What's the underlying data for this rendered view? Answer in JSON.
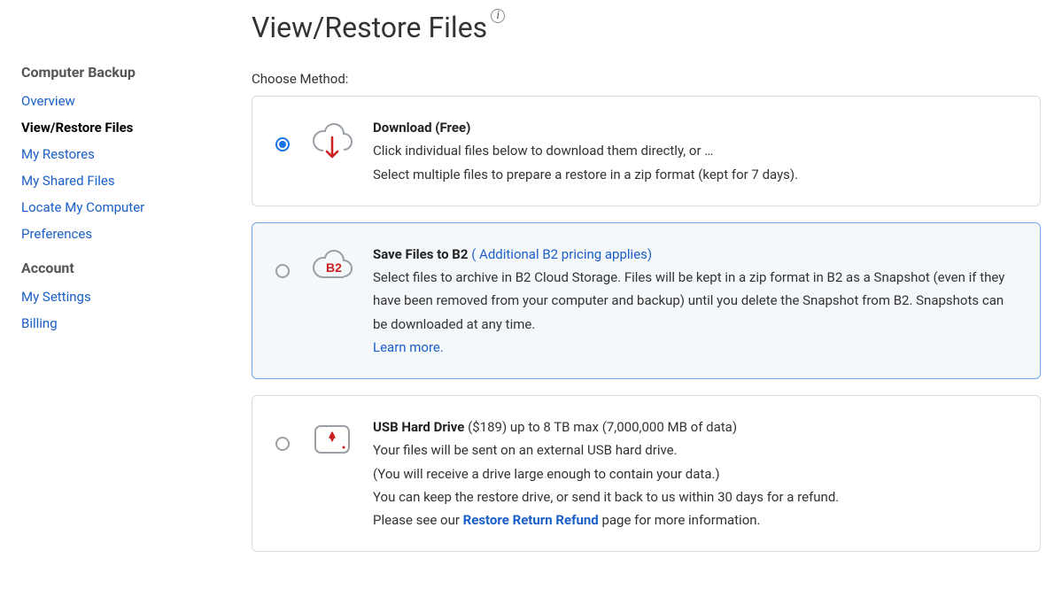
{
  "sidebar": {
    "section1_title": "Computer Backup",
    "items1": [
      {
        "label": "Overview",
        "active": false,
        "name": "overview"
      },
      {
        "label": "View/Restore Files",
        "active": true,
        "name": "view-restore-files"
      },
      {
        "label": "My Restores",
        "active": false,
        "name": "my-restores"
      },
      {
        "label": "My Shared Files",
        "active": false,
        "name": "my-shared-files"
      },
      {
        "label": "Locate My Computer",
        "active": false,
        "name": "locate-my-computer"
      },
      {
        "label": "Preferences",
        "active": false,
        "name": "preferences"
      }
    ],
    "section2_title": "Account",
    "items2": [
      {
        "label": "My Settings",
        "active": false,
        "name": "my-settings"
      },
      {
        "label": "Billing",
        "active": false,
        "name": "billing"
      }
    ]
  },
  "page": {
    "title": "View/Restore Files",
    "info_glyph": "i",
    "choose_label": "Choose Method:"
  },
  "methods": {
    "download": {
      "title": "Download (Free)",
      "line1": "Click individual files below to download them directly, or …",
      "line2": "Select multiple files to prepare a restore in a zip format (kept for 7 days)."
    },
    "b2": {
      "title": "Save Files to B2",
      "title_link": "( Additional B2 pricing applies)",
      "body": "Select files to archive in B2 Cloud Storage. Files will be kept in a zip format in B2 as a Snapshot (even if they have been removed from your computer and backup) until you delete the Snapshot from B2. Snapshots can be downloaded at any time.",
      "learn_more": "Learn more."
    },
    "usb": {
      "title": "USB Hard Drive",
      "title_extra": " ($189) up to 8 TB max (7,000,000 MB of data)",
      "line1": "Your files will be sent on an external USB hard drive.",
      "line2": "(You will receive a drive large enough to contain your data.)",
      "line3": "You can keep the restore drive, or send it back to us within 30 days for a refund.",
      "line4a": "Please see our ",
      "refund_link": "Restore Return Refund",
      "line4b": " page for more information."
    }
  }
}
